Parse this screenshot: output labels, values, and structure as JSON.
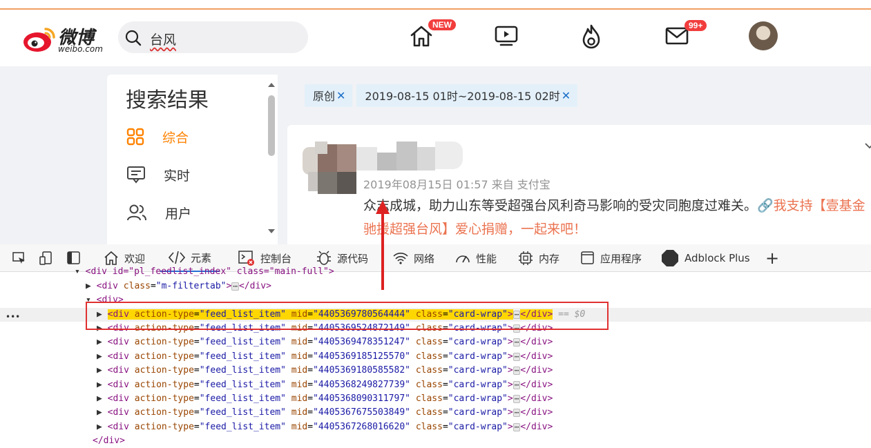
{
  "header": {
    "logo_cn": "微博",
    "logo_en": "weibo.com",
    "search_value": "台风",
    "home_badge": "NEW",
    "mail_badge": "99+"
  },
  "sidebar": {
    "title": "搜索结果",
    "items": [
      {
        "label": "综合",
        "icon": "grid-icon",
        "active": true
      },
      {
        "label": "实时",
        "icon": "message-icon",
        "active": false
      },
      {
        "label": "用户",
        "icon": "users-icon",
        "active": false
      }
    ]
  },
  "filters": {
    "tags": [
      {
        "label": "原创"
      },
      {
        "label": "2019-08-15 01时~2019-08-15 02时"
      }
    ],
    "close_glyph": "✕"
  },
  "post": {
    "meta": "2019年08月15日 01:57  来自 支付宝",
    "text": "众志成城，助力山东等受超强台风利奇马影响的受灾同胞度过难关。",
    "link_text": "🔗我支持【壹基金",
    "text_line2": "驰援超强台风】爱心捐赠，一起来吧！"
  },
  "devtools": {
    "tabs": [
      {
        "label": "欢迎",
        "icon": "home-icon"
      },
      {
        "label": "元素",
        "icon": "code-icon",
        "active": true
      },
      {
        "label": "控制台",
        "icon": "console-icon"
      },
      {
        "label": "源代码",
        "icon": "bug-icon"
      },
      {
        "label": "网络",
        "icon": "wifi-icon"
      },
      {
        "label": "性能",
        "icon": "gauge-icon"
      },
      {
        "label": "内存",
        "icon": "chip-icon"
      },
      {
        "label": "应用程序",
        "icon": "app-icon"
      },
      {
        "label": "Adblock Plus",
        "icon": "adblock-icon"
      }
    ],
    "add_tab": "+"
  },
  "dom": {
    "line0": "<div id=\"pl_feedlist_index\" class=\"main-full\">",
    "line1_tag": "div",
    "line1_attr": "class",
    "line1_val": "\"m-filtertab\"",
    "line2": "<div>",
    "attr_type": "action-type",
    "attr_type_val": "\"feed_list_item\"",
    "attr_mid": "mid",
    "attr_class": "class",
    "attr_class_val": "\"card-wrap\"",
    "selected_suffix": "== $0",
    "ellipsis": "⋯",
    "mids": [
      "\"4405369780564444\"",
      "\"4405369524872149\"",
      "\"4405369478351247\"",
      "\"4405369185125570\"",
      "\"4405369180585582\"",
      "\"4405368249827739\"",
      "\"4405368090311797\"",
      "\"4405367675503849\"",
      "\"4405367268016620\""
    ],
    "close_line": "</div>",
    "gutter_dots": "•••"
  }
}
